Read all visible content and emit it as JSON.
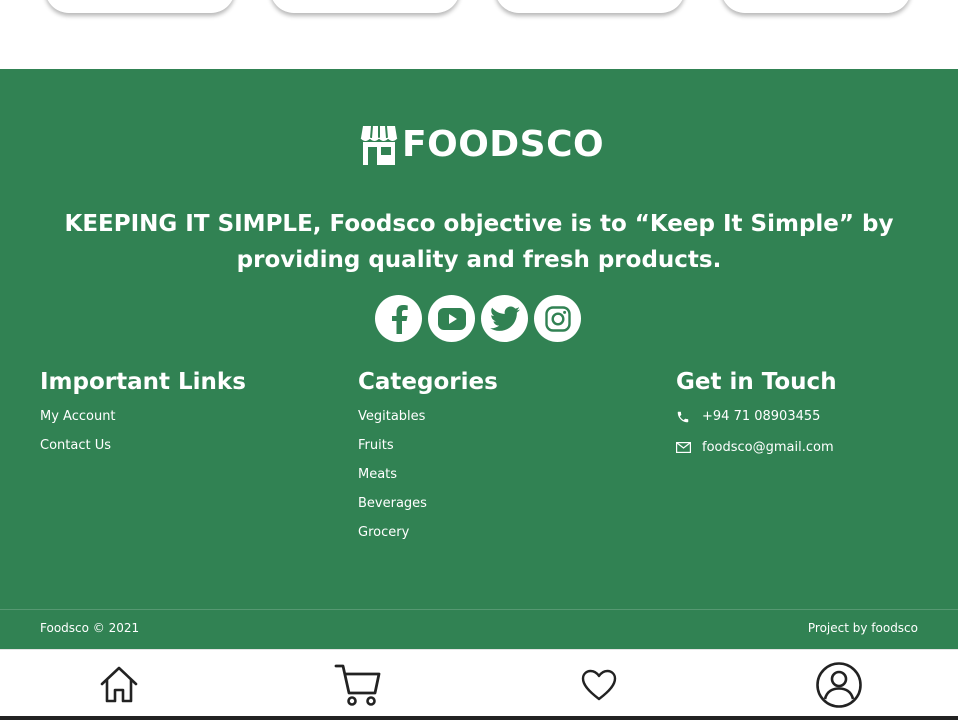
{
  "brand": {
    "name": "FOODSCO",
    "green": "#318253"
  },
  "footer": {
    "tagline": "KEEPING IT SIMPLE, Foodsco objective is to “Keep It Simple” by providing quality and fresh products.",
    "socials": [
      "facebook-icon",
      "youtube-icon",
      "twitter-icon",
      "instagram-icon"
    ],
    "important_links": {
      "title": "Important Links",
      "items": [
        "My Account",
        "Contact Us"
      ]
    },
    "categories": {
      "title": "Categories",
      "items": [
        "Vegitables",
        "Fruits",
        "Meats",
        "Beverages",
        "Grocery"
      ]
    },
    "contact": {
      "title": "Get in Touch",
      "phone": "+94 71 08903455",
      "email": "foodsco@gmail.com"
    },
    "copyright": "Foodsco © 2021",
    "credit": "Project by foodsco"
  },
  "bottom_nav": [
    "home-icon",
    "cart-icon",
    "heart-icon",
    "profile-icon"
  ]
}
